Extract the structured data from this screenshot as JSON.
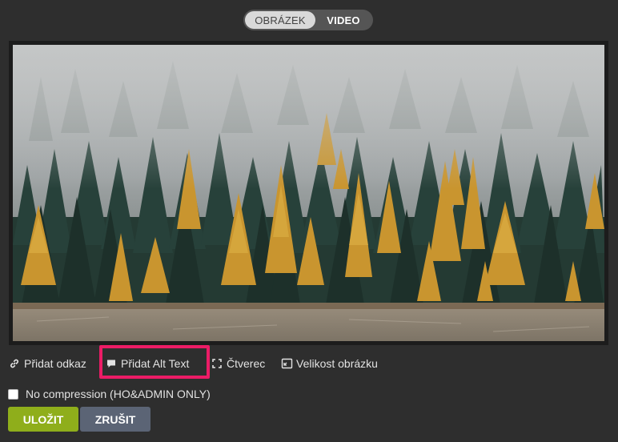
{
  "toggle": {
    "image_label": "OBRÁZEK",
    "video_label": "VIDEO",
    "selected": "OBRÁZEK"
  },
  "image": {
    "subject": "misty conifer forest with golden larches"
  },
  "actions": {
    "add_link": "Přidat odkaz",
    "add_alt_text": "Přidat Alt Text",
    "square": "Čtverec",
    "image_size": "Velikost obrázku"
  },
  "icons": {
    "add_link": "link-icon",
    "add_alt_text": "comment-icon",
    "square": "crop-icon",
    "image_size": "resize-icon"
  },
  "options": {
    "no_compression_label": "No compression (HO&ADMIN ONLY)",
    "no_compression_checked": false
  },
  "buttons": {
    "save": "ULOŽIT",
    "cancel": "ZRUŠIT"
  },
  "colors": {
    "background": "#2e2e2e",
    "highlight": "#ec1c66",
    "save": "#8fae1b",
    "cancel": "#5b6475"
  }
}
